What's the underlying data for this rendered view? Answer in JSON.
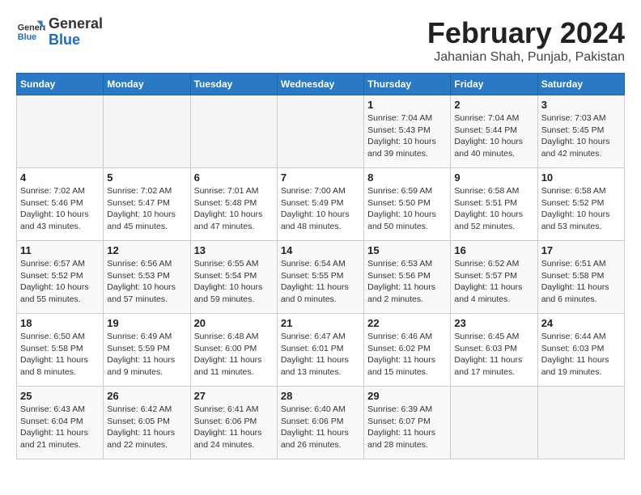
{
  "header": {
    "logo_general": "General",
    "logo_blue": "Blue",
    "month_year": "February 2024",
    "location": "Jahanian Shah, Punjab, Pakistan"
  },
  "days_of_week": [
    "Sunday",
    "Monday",
    "Tuesday",
    "Wednesday",
    "Thursday",
    "Friday",
    "Saturday"
  ],
  "weeks": [
    [
      {
        "day": "",
        "info": ""
      },
      {
        "day": "",
        "info": ""
      },
      {
        "day": "",
        "info": ""
      },
      {
        "day": "",
        "info": ""
      },
      {
        "day": "1",
        "info": "Sunrise: 7:04 AM\nSunset: 5:43 PM\nDaylight: 10 hours and 39 minutes."
      },
      {
        "day": "2",
        "info": "Sunrise: 7:04 AM\nSunset: 5:44 PM\nDaylight: 10 hours and 40 minutes."
      },
      {
        "day": "3",
        "info": "Sunrise: 7:03 AM\nSunset: 5:45 PM\nDaylight: 10 hours and 42 minutes."
      }
    ],
    [
      {
        "day": "4",
        "info": "Sunrise: 7:02 AM\nSunset: 5:46 PM\nDaylight: 10 hours and 43 minutes."
      },
      {
        "day": "5",
        "info": "Sunrise: 7:02 AM\nSunset: 5:47 PM\nDaylight: 10 hours and 45 minutes."
      },
      {
        "day": "6",
        "info": "Sunrise: 7:01 AM\nSunset: 5:48 PM\nDaylight: 10 hours and 47 minutes."
      },
      {
        "day": "7",
        "info": "Sunrise: 7:00 AM\nSunset: 5:49 PM\nDaylight: 10 hours and 48 minutes."
      },
      {
        "day": "8",
        "info": "Sunrise: 6:59 AM\nSunset: 5:50 PM\nDaylight: 10 hours and 50 minutes."
      },
      {
        "day": "9",
        "info": "Sunrise: 6:58 AM\nSunset: 5:51 PM\nDaylight: 10 hours and 52 minutes."
      },
      {
        "day": "10",
        "info": "Sunrise: 6:58 AM\nSunset: 5:52 PM\nDaylight: 10 hours and 53 minutes."
      }
    ],
    [
      {
        "day": "11",
        "info": "Sunrise: 6:57 AM\nSunset: 5:52 PM\nDaylight: 10 hours and 55 minutes."
      },
      {
        "day": "12",
        "info": "Sunrise: 6:56 AM\nSunset: 5:53 PM\nDaylight: 10 hours and 57 minutes."
      },
      {
        "day": "13",
        "info": "Sunrise: 6:55 AM\nSunset: 5:54 PM\nDaylight: 10 hours and 59 minutes."
      },
      {
        "day": "14",
        "info": "Sunrise: 6:54 AM\nSunset: 5:55 PM\nDaylight: 11 hours and 0 minutes."
      },
      {
        "day": "15",
        "info": "Sunrise: 6:53 AM\nSunset: 5:56 PM\nDaylight: 11 hours and 2 minutes."
      },
      {
        "day": "16",
        "info": "Sunrise: 6:52 AM\nSunset: 5:57 PM\nDaylight: 11 hours and 4 minutes."
      },
      {
        "day": "17",
        "info": "Sunrise: 6:51 AM\nSunset: 5:58 PM\nDaylight: 11 hours and 6 minutes."
      }
    ],
    [
      {
        "day": "18",
        "info": "Sunrise: 6:50 AM\nSunset: 5:58 PM\nDaylight: 11 hours and 8 minutes."
      },
      {
        "day": "19",
        "info": "Sunrise: 6:49 AM\nSunset: 5:59 PM\nDaylight: 11 hours and 9 minutes."
      },
      {
        "day": "20",
        "info": "Sunrise: 6:48 AM\nSunset: 6:00 PM\nDaylight: 11 hours and 11 minutes."
      },
      {
        "day": "21",
        "info": "Sunrise: 6:47 AM\nSunset: 6:01 PM\nDaylight: 11 hours and 13 minutes."
      },
      {
        "day": "22",
        "info": "Sunrise: 6:46 AM\nSunset: 6:02 PM\nDaylight: 11 hours and 15 minutes."
      },
      {
        "day": "23",
        "info": "Sunrise: 6:45 AM\nSunset: 6:03 PM\nDaylight: 11 hours and 17 minutes."
      },
      {
        "day": "24",
        "info": "Sunrise: 6:44 AM\nSunset: 6:03 PM\nDaylight: 11 hours and 19 minutes."
      }
    ],
    [
      {
        "day": "25",
        "info": "Sunrise: 6:43 AM\nSunset: 6:04 PM\nDaylight: 11 hours and 21 minutes."
      },
      {
        "day": "26",
        "info": "Sunrise: 6:42 AM\nSunset: 6:05 PM\nDaylight: 11 hours and 22 minutes."
      },
      {
        "day": "27",
        "info": "Sunrise: 6:41 AM\nSunset: 6:06 PM\nDaylight: 11 hours and 24 minutes."
      },
      {
        "day": "28",
        "info": "Sunrise: 6:40 AM\nSunset: 6:06 PM\nDaylight: 11 hours and 26 minutes."
      },
      {
        "day": "29",
        "info": "Sunrise: 6:39 AM\nSunset: 6:07 PM\nDaylight: 11 hours and 28 minutes."
      },
      {
        "day": "",
        "info": ""
      },
      {
        "day": "",
        "info": ""
      }
    ]
  ]
}
